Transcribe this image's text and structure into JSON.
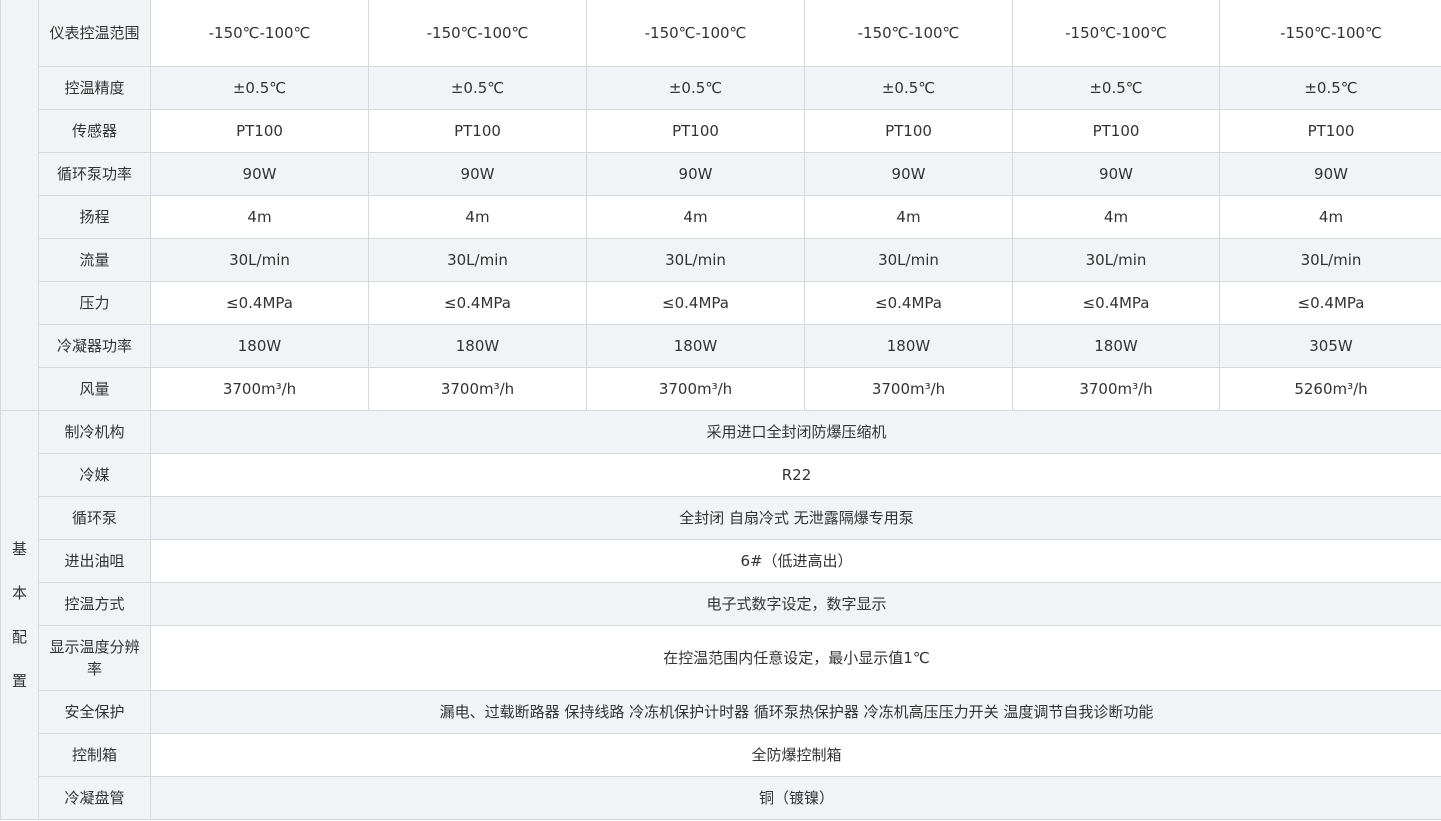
{
  "spec_rows": [
    {
      "label": "仪表控温范围",
      "values": [
        "-150℃-100℃",
        "-150℃-100℃",
        "-150℃-100℃",
        "-150℃-100℃",
        "-150℃-100℃",
        "-150℃-100℃"
      ]
    },
    {
      "label": "控温精度",
      "values": [
        "±0.5℃",
        "±0.5℃",
        "±0.5℃",
        "±0.5℃",
        "±0.5℃",
        "±0.5℃"
      ]
    },
    {
      "label": "传感器",
      "values": [
        "PT100",
        "PT100",
        "PT100",
        "PT100",
        "PT100",
        "PT100"
      ]
    },
    {
      "label": "循环泵功率",
      "values": [
        "90W",
        "90W",
        "90W",
        "90W",
        "90W",
        "90W"
      ]
    },
    {
      "label": "扬程",
      "values": [
        "4m",
        "4m",
        "4m",
        "4m",
        "4m",
        "4m"
      ]
    },
    {
      "label": "流量",
      "values": [
        "30L/min",
        "30L/min",
        "30L/min",
        "30L/min",
        "30L/min",
        "30L/min"
      ]
    },
    {
      "label": "压力",
      "values": [
        "≤0.4MPa",
        "≤0.4MPa",
        "≤0.4MPa",
        "≤0.4MPa",
        "≤0.4MPa",
        "≤0.4MPa"
      ]
    },
    {
      "label": "冷凝器功率",
      "values": [
        "180W",
        "180W",
        "180W",
        "180W",
        "180W",
        "305W"
      ]
    },
    {
      "label": "风量",
      "values": [
        "3700m³/h",
        "3700m³/h",
        "3700m³/h",
        "3700m³/h",
        "3700m³/h",
        "5260m³/h"
      ]
    }
  ],
  "basic_config": {
    "group_label": "基本配置",
    "rows": [
      {
        "label": "制冷机构",
        "value": "采用进口全封闭防爆压缩机"
      },
      {
        "label": "冷媒",
        "value": "R22"
      },
      {
        "label": "循环泵",
        "value": "全封闭 自扇冷式 无泄露隔爆专用泵"
      },
      {
        "label": "进出油咀",
        "value": "6#（低进高出）"
      },
      {
        "label": "控温方式",
        "value": "电子式数字设定，数字显示"
      },
      {
        "label": "显示温度分辨率",
        "value": "在控温范围内任意设定，最小显示值1℃"
      },
      {
        "label": "安全保护",
        "value": "漏电、过载断路器 保持线路 冷冻机保护计时器 循环泵热保护器  冷冻机高压压力开关 温度调节自我诊断功能"
      },
      {
        "label": "控制箱",
        "value": "全防爆控制箱"
      },
      {
        "label": "冷凝盘管",
        "value": "铜（镀镍）"
      }
    ]
  }
}
